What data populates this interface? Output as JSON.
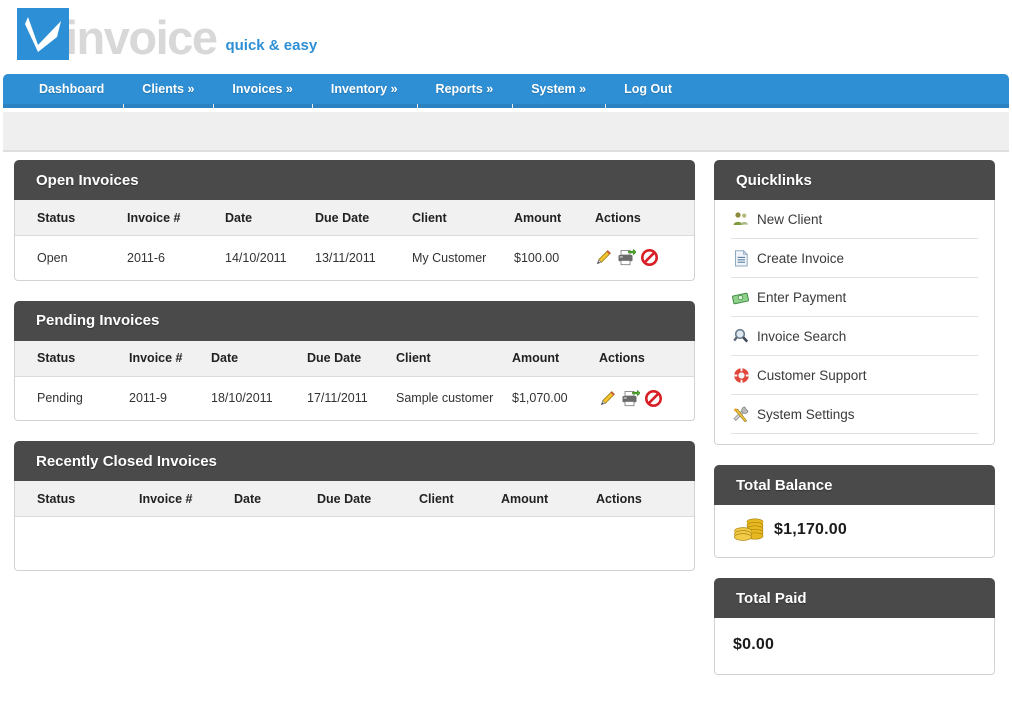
{
  "brand": {
    "logo_icon": "checkmark-logo-icon",
    "word": "invoice",
    "tagline": "quick & easy",
    "accent_color": "#2d8fd5",
    "word_color": "#d8d8d8"
  },
  "nav": {
    "items": [
      {
        "label": "Dashboard",
        "name": "dashboard"
      },
      {
        "label": "Clients »",
        "name": "clients"
      },
      {
        "label": "Invoices »",
        "name": "invoices"
      },
      {
        "label": "Inventory »",
        "name": "inventory"
      },
      {
        "label": "Reports »",
        "name": "reports"
      },
      {
        "label": "System »",
        "name": "system"
      },
      {
        "label": "Log Out",
        "name": "log-out"
      }
    ]
  },
  "panels": {
    "open_invoices": {
      "title": "Open Invoices",
      "columns": [
        "Status",
        "Invoice #",
        "Date",
        "Due Date",
        "Client",
        "Amount",
        "Actions"
      ],
      "rows": [
        {
          "status": "Open",
          "invoice_no": "2011-6",
          "date": "14/10/2011",
          "due_date": "13/11/2011",
          "client": "My Customer",
          "amount": "$100.00",
          "actions": [
            "edit-pencil-icon",
            "printer-icon",
            "cancel-icon"
          ]
        }
      ]
    },
    "pending_invoices": {
      "title": "Pending Invoices",
      "columns": [
        "Status",
        "Invoice #",
        "Date",
        "Due Date",
        "Client",
        "Amount",
        "Actions"
      ],
      "rows": [
        {
          "status": "Pending",
          "invoice_no": "2011-9",
          "date": "18/10/2011",
          "due_date": "17/11/2011",
          "client": "Sample customer",
          "amount": "$1,070.00",
          "actions": [
            "edit-pencil-icon",
            "printer-icon",
            "cancel-icon"
          ]
        }
      ]
    },
    "recently_closed_invoices": {
      "title": "Recently Closed Invoices",
      "columns": [
        "Status",
        "Invoice #",
        "Date",
        "Due Date",
        "Client",
        "Amount",
        "Actions"
      ],
      "rows": []
    },
    "quicklinks": {
      "title": "Quicklinks",
      "items": [
        {
          "label": "New Client",
          "icon": "users-icon"
        },
        {
          "label": "Create Invoice",
          "icon": "document-icon"
        },
        {
          "label": "Enter Payment",
          "icon": "money-icon"
        },
        {
          "label": "Invoice Search",
          "icon": "magnifier-icon"
        },
        {
          "label": "Customer Support",
          "icon": "lifebuoy-icon"
        },
        {
          "label": "System Settings",
          "icon": "tools-icon"
        }
      ]
    },
    "total_balance": {
      "title": "Total Balance",
      "icon": "coins-icon",
      "value": "$1,170.00"
    },
    "total_paid": {
      "title": "Total Paid",
      "value": "$0.00"
    }
  },
  "colors": {
    "nav_blue": "#2e8fd4",
    "panel_header": "#4a4a4a",
    "status_open_green": "#2e8b2e",
    "subnav_gray": "#efefef"
  }
}
